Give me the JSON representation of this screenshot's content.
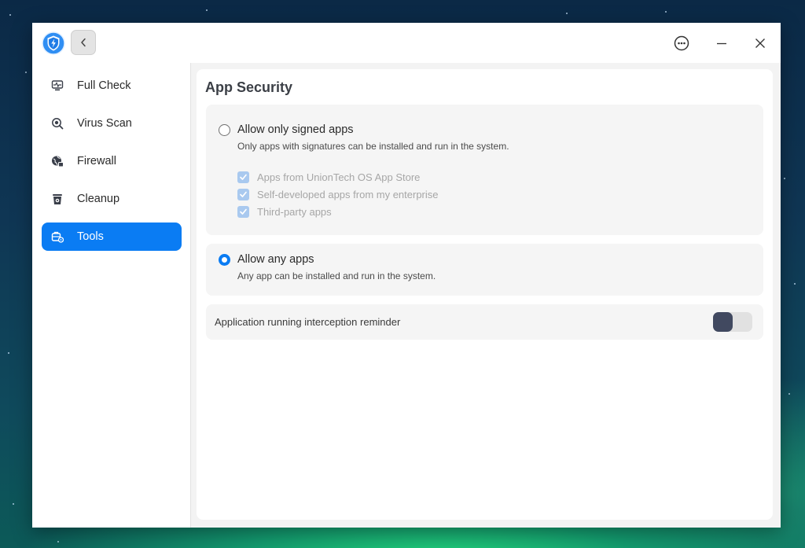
{
  "window": {
    "back_button": "back",
    "more_button": "more",
    "minimize_button": "minimize",
    "close_button": "close"
  },
  "sidebar": {
    "items": [
      {
        "label": "Full Check",
        "icon": "pulse-monitor-icon",
        "active": false
      },
      {
        "label": "Virus Scan",
        "icon": "scan-search-icon",
        "active": false
      },
      {
        "label": "Firewall",
        "icon": "firewall-globe-icon",
        "active": false
      },
      {
        "label": "Cleanup",
        "icon": "trash-bin-icon",
        "active": false
      },
      {
        "label": "Tools",
        "icon": "toolbox-icon",
        "active": true
      }
    ]
  },
  "main": {
    "title": "App Security",
    "signed_option": {
      "title": "Allow only signed apps",
      "description": "Only apps with signatures can be installed and run in the system.",
      "selected": false,
      "sources": [
        {
          "label": "Apps from UnionTech OS App Store",
          "checked": true,
          "disabled": true
        },
        {
          "label": "Self-developed apps from my enterprise",
          "checked": true,
          "disabled": true
        },
        {
          "label": "Third-party apps",
          "checked": true,
          "disabled": true
        }
      ]
    },
    "any_option": {
      "title": "Allow any apps",
      "description": "Any app can be installed and run in the system.",
      "selected": true
    },
    "interception": {
      "label": "Application running interception reminder",
      "enabled": false
    }
  },
  "colors": {
    "accent": "#0a7cf3",
    "toggle_knob": "#414960",
    "disabled_checkbox": "#a9c9ef"
  }
}
